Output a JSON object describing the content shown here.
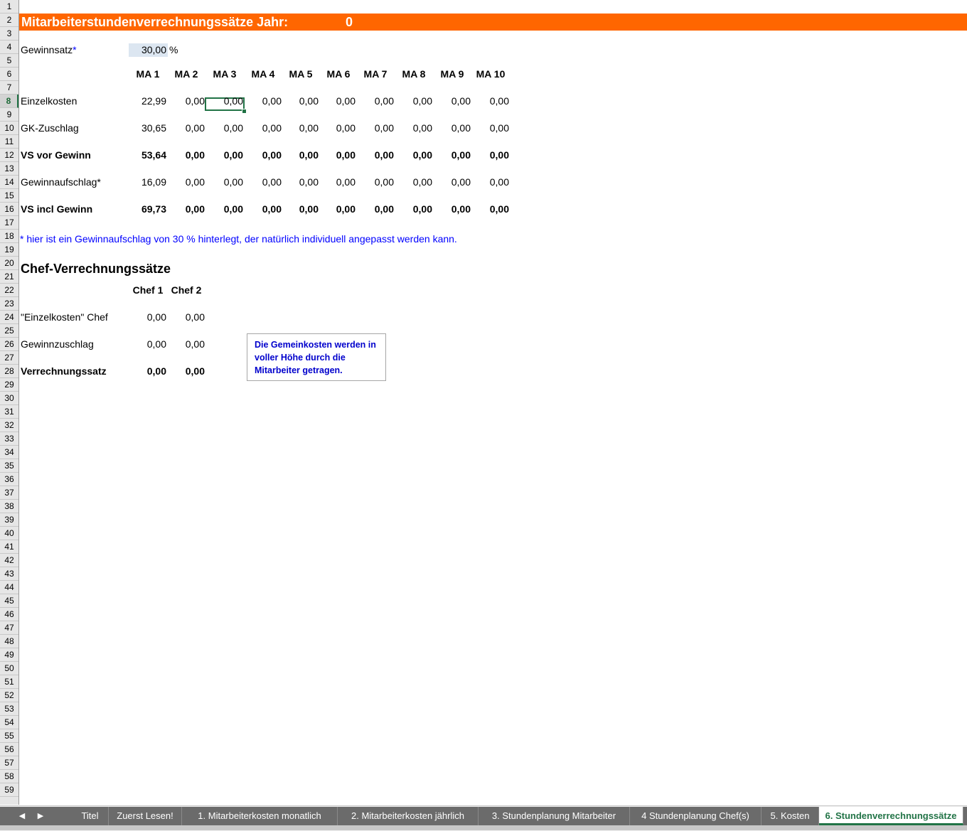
{
  "sheet": {
    "title": "Mitarbeiterstundenverrechnungssätze Jahr:",
    "year": "0",
    "gewinnsatz_label": "Gewinnsatz",
    "gewinnsatz_star": "*",
    "gewinnsatz_value": "30,00",
    "gewinnsatz_unit": "%",
    "ma_headers": [
      "MA 1",
      "MA 2",
      "MA 3",
      "MA 4",
      "MA 5",
      "MA 6",
      "MA 7",
      "MA 8",
      "MA 9",
      "MA 10"
    ],
    "rows": [
      {
        "label": "Einzelkosten",
        "bold": false,
        "values": [
          "22,99",
          "0,00",
          "0,00",
          "0,00",
          "0,00",
          "0,00",
          "0,00",
          "0,00",
          "0,00",
          "0,00"
        ]
      },
      {
        "label": "GK-Zuschlag",
        "bold": false,
        "values": [
          "30,65",
          "0,00",
          "0,00",
          "0,00",
          "0,00",
          "0,00",
          "0,00",
          "0,00",
          "0,00",
          "0,00"
        ]
      },
      {
        "label": "VS vor Gewinn",
        "bold": true,
        "values": [
          "53,64",
          "0,00",
          "0,00",
          "0,00",
          "0,00",
          "0,00",
          "0,00",
          "0,00",
          "0,00",
          "0,00"
        ]
      },
      {
        "label": "Gewinnaufschlag*",
        "bold": false,
        "values": [
          "16,09",
          "0,00",
          "0,00",
          "0,00",
          "0,00",
          "0,00",
          "0,00",
          "0,00",
          "0,00",
          "0,00"
        ]
      },
      {
        "label": "VS incl Gewinn",
        "bold": true,
        "values": [
          "69,73",
          "0,00",
          "0,00",
          "0,00",
          "0,00",
          "0,00",
          "0,00",
          "0,00",
          "0,00",
          "0,00"
        ]
      }
    ],
    "note": "* hier ist ein Gewinnaufschlag von 30 % hinterlegt, der natürlich individuell angepasst werden kann.",
    "chef_title": "Chef-Verrechnungssätze",
    "chef_headers": [
      "Chef 1",
      "Chef 2"
    ],
    "chef_rows": [
      {
        "label": "\"Einzelkosten\" Chef",
        "bold": false,
        "values": [
          "0,00",
          "0,00"
        ]
      },
      {
        "label": "Gewinnzuschlag",
        "bold": false,
        "values": [
          "0,00",
          "0,00"
        ]
      },
      {
        "label": "Verrechnungssatz",
        "bold": true,
        "values": [
          "0,00",
          "0,00"
        ]
      }
    ],
    "textbox": "Die Gemeinkosten werden in voller Höhe durch die Mitarbeiter getragen.",
    "row_count": 59,
    "selected_row": 8,
    "selected_cell": "MA 3 / Einzelkosten"
  },
  "tabs": [
    "Titel",
    "Zuerst Lesen!",
    "1. Mitarbeiterkosten monatlich",
    "2. Mitarbeiterkosten jährlich",
    "3. Stundenplanung Mitarbeiter",
    "4 Stundenplanung Chef(s)",
    "5. Kosten",
    "6. Stundenverrechnungssätze"
  ],
  "active_tab": "6. Stundenverrechnungssätze",
  "nav": {
    "prev": "◀",
    "next": "▶"
  },
  "colors": {
    "title_bg": "#ff6600",
    "accent": "#217346",
    "note": "#0000ff",
    "input_bg": "#dce6f1"
  }
}
